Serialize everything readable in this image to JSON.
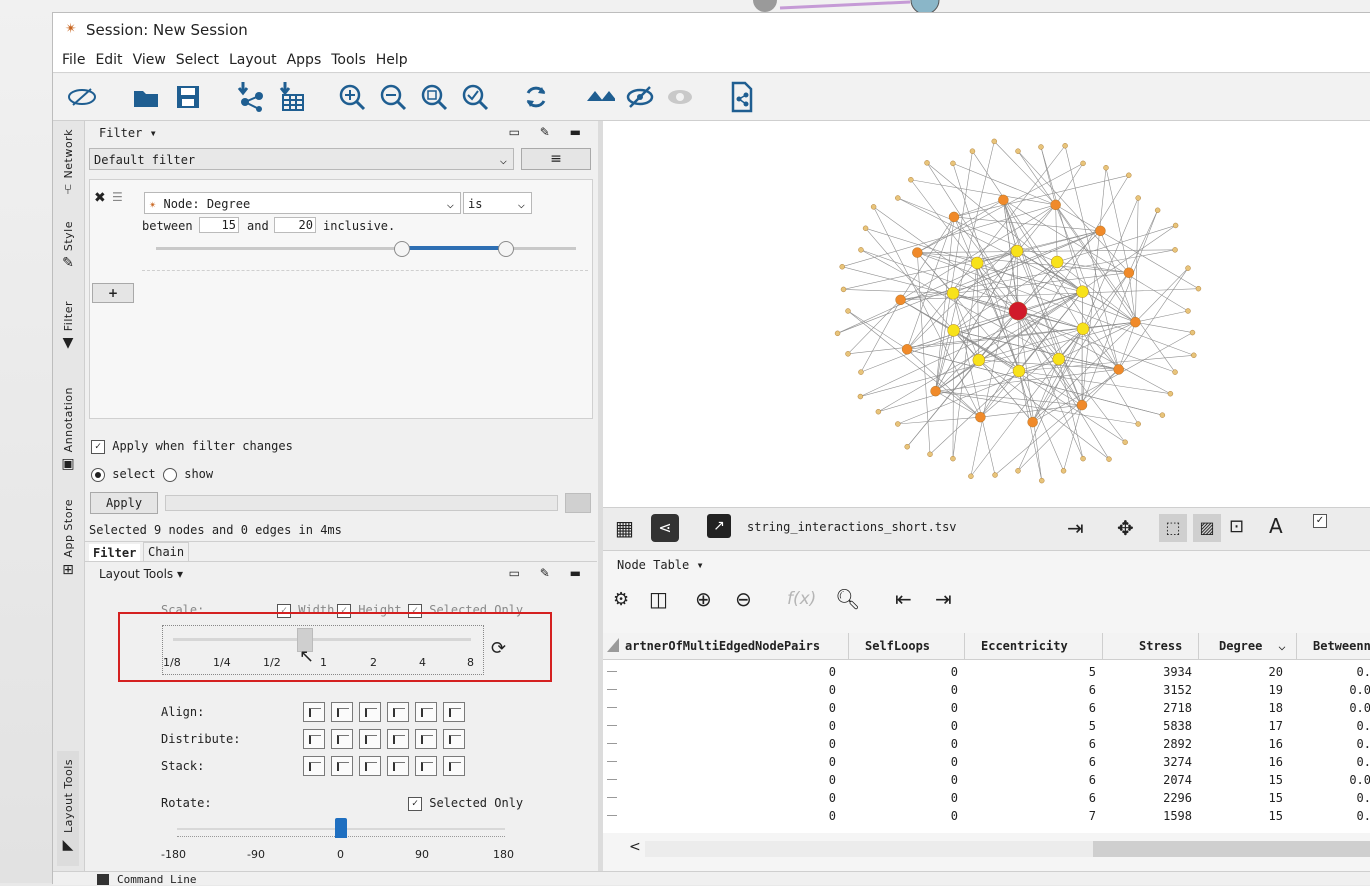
{
  "window": {
    "title": "Session: New Session"
  },
  "menu": [
    "File",
    "Edit",
    "View",
    "Select",
    "Layout",
    "Apps",
    "Tools",
    "Help"
  ],
  "toolbar_icons": [
    "network-icon",
    "open-folder-icon",
    "save-icon",
    "import-network-icon",
    "import-table-icon",
    "zoom-in-icon",
    "zoom-out-icon",
    "zoom-fit-icon",
    "zoom-selected-icon",
    "refresh-icon",
    "show-all-icon",
    "hide-icon",
    "eye-icon",
    "export-icon"
  ],
  "sidetabs": {
    "network": "Network",
    "style": "Style",
    "filter": "Filter",
    "annotation": "Annotation",
    "app_store": "App Store",
    "layout_tools": "Layout Tools"
  },
  "filter_panel": {
    "title": "Filter ▾",
    "preset": "Default filter",
    "node_filter": "Node: Degree",
    "operator": "is",
    "between_label": "between",
    "min_value": "15",
    "and_label": "and",
    "max_value": "20",
    "inclusive_label": "inclusive.",
    "add_label": "+",
    "apply_when_changed": "Apply when filter changes",
    "select_label": "select",
    "show_label": "show",
    "apply_button": "Apply",
    "status": "Selected 9 nodes and 0 edges in 4ms",
    "tabs": [
      "Filter",
      "Chain"
    ]
  },
  "layout_tools": {
    "title": "Layout Tools ▾",
    "scale_label": "Scale:",
    "width_label": "Width",
    "height_label": "Height",
    "selected_only_label": "Selected Only",
    "scale_ticks": [
      "1/8",
      "1/4",
      "1/2",
      "1",
      "2",
      "4",
      "8"
    ],
    "align_label": "Align:",
    "distribute_label": "Distribute:",
    "stack_label": "Stack:",
    "rotate_label": "Rotate:",
    "rotate_selected_only": "Selected Only",
    "rotate_ticks": [
      "-180",
      "-90",
      "0",
      "90",
      "180"
    ],
    "rotate_value": 0
  },
  "network_view": {
    "file_name": "string_interactions_short.tsv"
  },
  "node_table": {
    "title": "Node Table ▾",
    "formula_label": "f(x)",
    "columns": [
      "artnerOfMultiEdgedNodePairs",
      "SelfLoops",
      "Eccentricity",
      "Stress",
      "Degree",
      "Betweenne"
    ],
    "rows": [
      [
        "0",
        "0",
        "5",
        "3934",
        "20",
        "0."
      ],
      [
        "0",
        "0",
        "6",
        "3152",
        "19",
        "0.0"
      ],
      [
        "0",
        "0",
        "6",
        "2718",
        "18",
        "0.0"
      ],
      [
        "0",
        "0",
        "5",
        "5838",
        "17",
        "0."
      ],
      [
        "0",
        "0",
        "6",
        "2892",
        "16",
        "0."
      ],
      [
        "0",
        "0",
        "6",
        "3274",
        "16",
        "0."
      ],
      [
        "0",
        "0",
        "6",
        "2074",
        "15",
        "0.0"
      ],
      [
        "0",
        "0",
        "6",
        "2296",
        "15",
        "0."
      ],
      [
        "0",
        "0",
        "7",
        "1598",
        "15",
        "0."
      ]
    ],
    "scroll_left": "<"
  },
  "status_bar": {
    "command_line": "Command Line"
  },
  "colors": {
    "accent": "#1f5e91",
    "highlight_box": "#d42020",
    "hub_node": "#d01a2a",
    "orange_node": "#f08a2a",
    "yellow_node": "#f7e21a"
  }
}
